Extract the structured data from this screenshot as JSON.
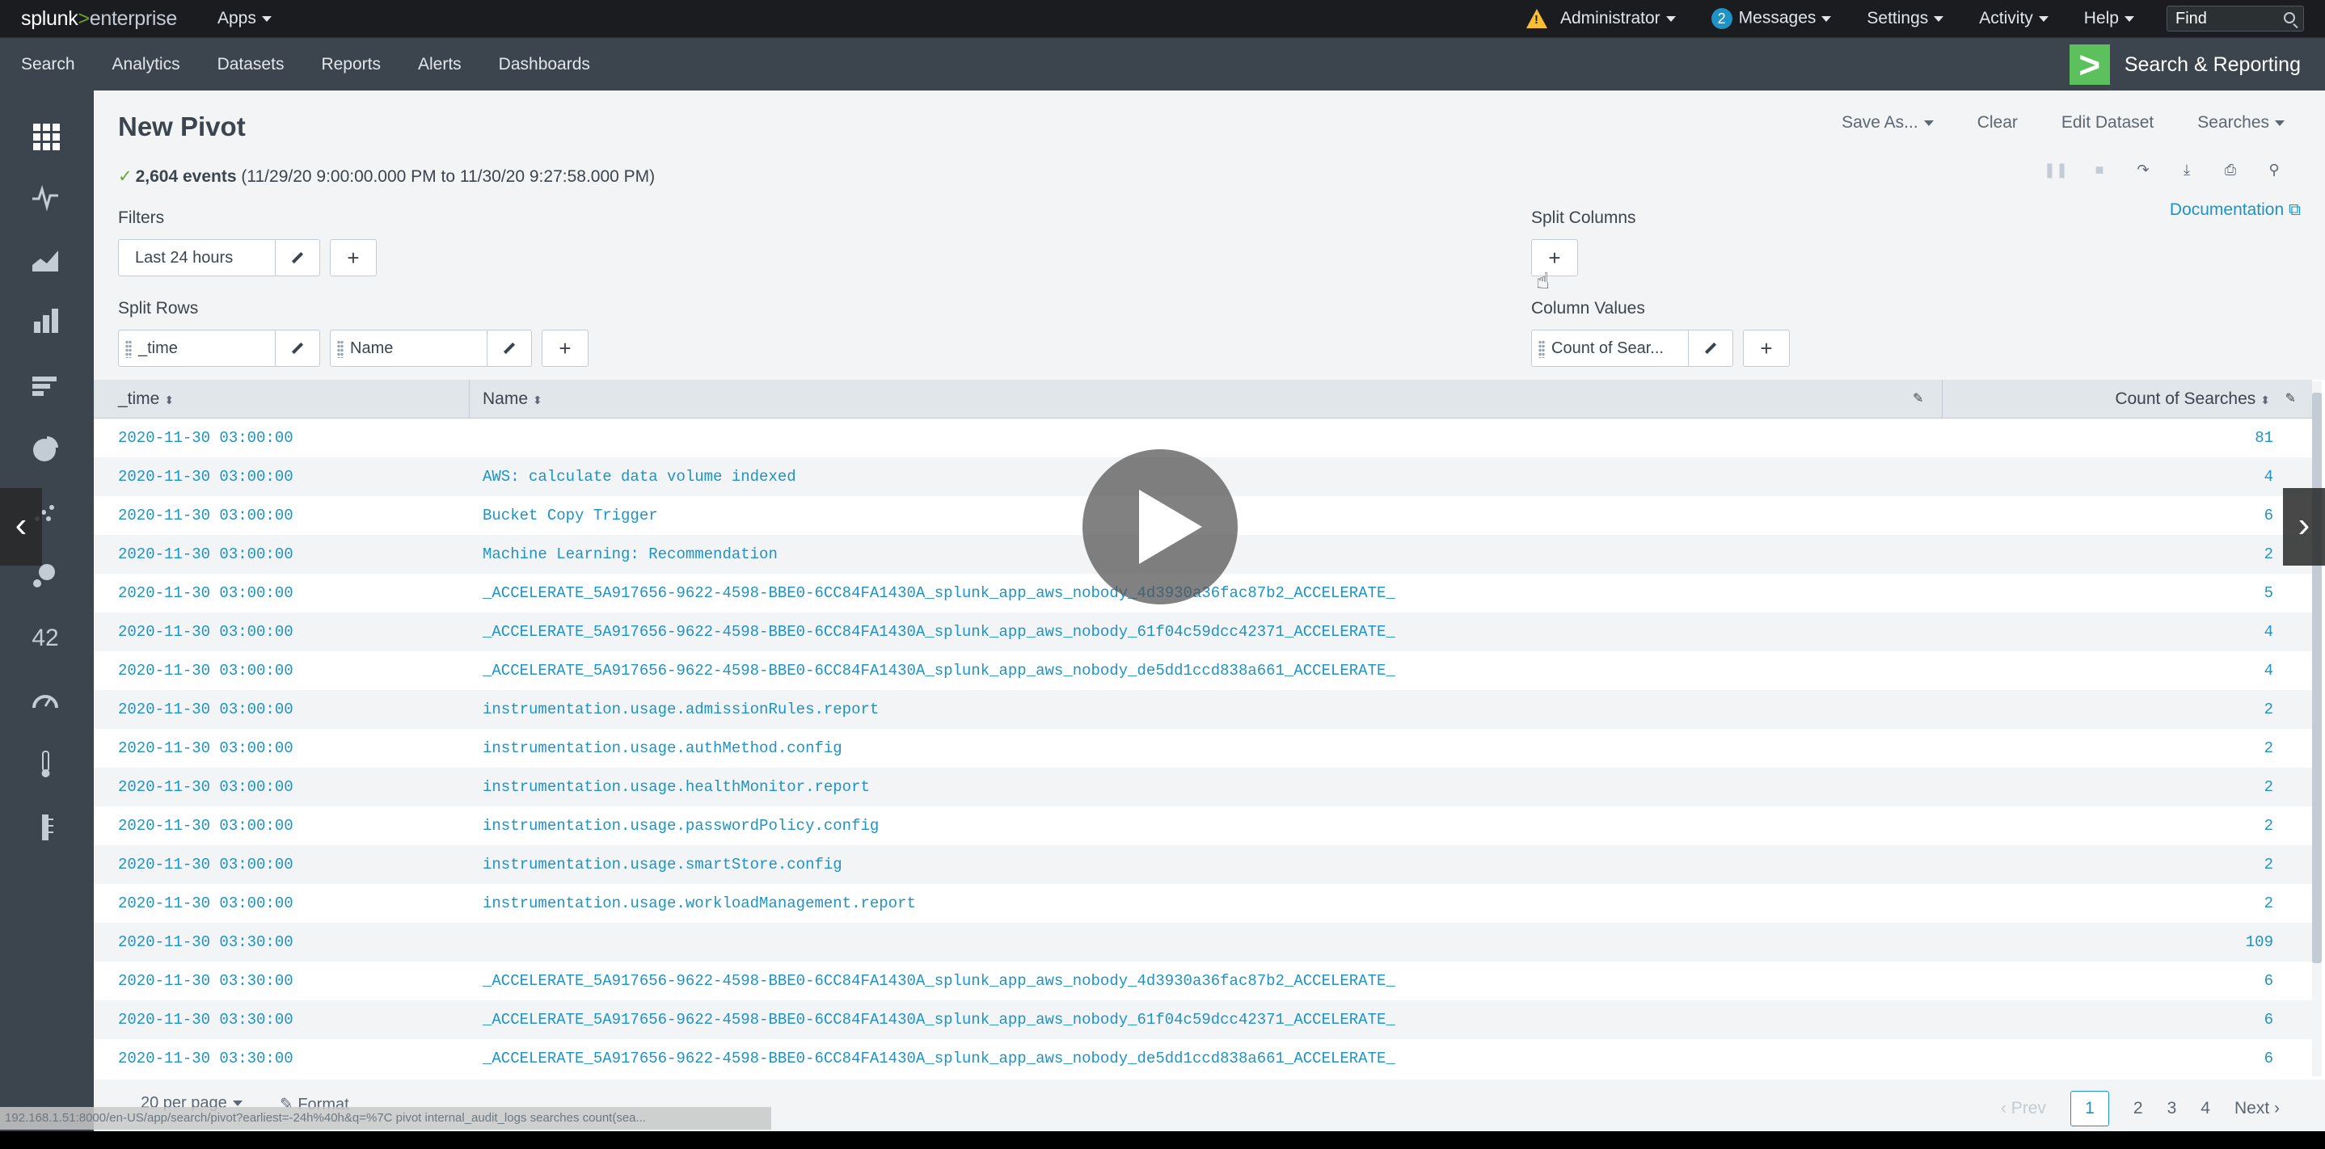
{
  "topbar": {
    "logo_splunk": "splunk",
    "logo_gt": ">",
    "logo_product": "enterprise",
    "apps": "Apps",
    "user": "Administrator",
    "messages_count": "2",
    "messages": "Messages",
    "settings": "Settings",
    "activity": "Activity",
    "help": "Help",
    "find_placeholder": "Find"
  },
  "appnav": {
    "items": [
      "Search",
      "Analytics",
      "Datasets",
      "Reports",
      "Alerts",
      "Dashboards"
    ],
    "app_title": "Search & Reporting"
  },
  "sidebar": {
    "counter_label": "42"
  },
  "page": {
    "title": "New Pivot",
    "save_as": "Save As...",
    "clear": "Clear",
    "edit_dataset": "Edit Dataset",
    "searches": "Searches",
    "event_count": "2,604 events",
    "event_range": "(11/29/20 9:00:00.000 PM to 11/30/20 9:27:58.000 PM)",
    "documentation": "Documentation"
  },
  "pivot": {
    "filters_label": "Filters",
    "filter_value": "Last 24 hours",
    "split_columns_label": "Split Columns",
    "split_rows_label": "Split Rows",
    "split_row_1": "_time",
    "split_row_2": "Name",
    "column_values_label": "Column Values",
    "column_value_1": "Count of Sear..."
  },
  "table": {
    "columns": [
      "_time",
      "Name",
      "Count of Searches"
    ],
    "rows": [
      {
        "time": "2020-11-30 03:00:00",
        "name": "",
        "count": "81"
      },
      {
        "time": "2020-11-30 03:00:00",
        "name": "AWS: calculate data volume indexed",
        "count": "4"
      },
      {
        "time": "2020-11-30 03:00:00",
        "name": "Bucket Copy Trigger",
        "count": "6"
      },
      {
        "time": "2020-11-30 03:00:00",
        "name": "Machine Learning: Recommendation",
        "count": "2"
      },
      {
        "time": "2020-11-30 03:00:00",
        "name": "_ACCELERATE_5A917656-9622-4598-BBE0-6CC84FA1430A_splunk_app_aws_nobody_4d3930a36fac87b2_ACCELERATE_",
        "count": "5"
      },
      {
        "time": "2020-11-30 03:00:00",
        "name": "_ACCELERATE_5A917656-9622-4598-BBE0-6CC84FA1430A_splunk_app_aws_nobody_61f04c59dcc42371_ACCELERATE_",
        "count": "4"
      },
      {
        "time": "2020-11-30 03:00:00",
        "name": "_ACCELERATE_5A917656-9622-4598-BBE0-6CC84FA1430A_splunk_app_aws_nobody_de5dd1ccd838a661_ACCELERATE_",
        "count": "4"
      },
      {
        "time": "2020-11-30 03:00:00",
        "name": "instrumentation.usage.admissionRules.report",
        "count": "2"
      },
      {
        "time": "2020-11-30 03:00:00",
        "name": "instrumentation.usage.authMethod.config",
        "count": "2"
      },
      {
        "time": "2020-11-30 03:00:00",
        "name": "instrumentation.usage.healthMonitor.report",
        "count": "2"
      },
      {
        "time": "2020-11-30 03:00:00",
        "name": "instrumentation.usage.passwordPolicy.config",
        "count": "2"
      },
      {
        "time": "2020-11-30 03:00:00",
        "name": "instrumentation.usage.smartStore.config",
        "count": "2"
      },
      {
        "time": "2020-11-30 03:00:00",
        "name": "instrumentation.usage.workloadManagement.report",
        "count": "2"
      },
      {
        "time": "2020-11-30 03:30:00",
        "name": "",
        "count": "109"
      },
      {
        "time": "2020-11-30 03:30:00",
        "name": "_ACCELERATE_5A917656-9622-4598-BBE0-6CC84FA1430A_splunk_app_aws_nobody_4d3930a36fac87b2_ACCELERATE_",
        "count": "6"
      },
      {
        "time": "2020-11-30 03:30:00",
        "name": "_ACCELERATE_5A917656-9622-4598-BBE0-6CC84FA1430A_splunk_app_aws_nobody_61f04c59dcc42371_ACCELERATE_",
        "count": "6"
      },
      {
        "time": "2020-11-30 03:30:00",
        "name": "_ACCELERATE_5A917656-9622-4598-BBE0-6CC84FA1430A_splunk_app_aws_nobody_de5dd1ccd838a661_ACCELERATE_",
        "count": "6"
      }
    ]
  },
  "footer": {
    "per_page": "20 per page",
    "format": "Format",
    "prev": "Prev",
    "pages": [
      "1",
      "2",
      "3",
      "4"
    ],
    "next": "Next"
  },
  "status_url": "192.168.1.51:8000/en-US/app/search/pivot?earliest=-24h%40h&q=%7C pivot internal_audit_logs searches count(sea...",
  "colors": {
    "topbar_bg": "#1a1c20",
    "nav_bg": "#3c444d",
    "accent_link": "#1e93c6",
    "app_logo_green": "#5cc05c",
    "warning": "#f8be34"
  }
}
